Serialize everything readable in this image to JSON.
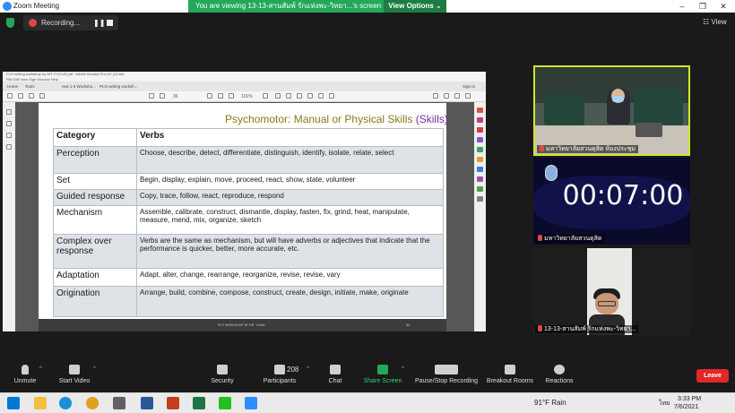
{
  "window": {
    "title": "Zoom Meeting",
    "controls": [
      "–",
      "❐",
      "✕"
    ]
  },
  "share_banner": {
    "message": "You are viewing 13-13-สานสัมพ์ รักแห่งพะ-วิทยา...'s screen",
    "view_options": "View Options ⌄"
  },
  "recording": {
    "label": "Recording...",
    "pause": "❚❚"
  },
  "view_button": "☷ View",
  "acrobat": {
    "title": "PLO writing workshop by DR. FOCUS.pdf - Adobe Acrobat Pro DC (32-bit)",
    "menu": "File   Edit   View   Sign   Window   Help",
    "tabs": [
      "Home",
      "Tools",
      "nea 1-3 Worksho...",
      "PLO writing worksh..."
    ],
    "sign_in": "Sign In",
    "zoom": "101%",
    "page": "36"
  },
  "slide": {
    "title_main": "Psychomotor: Manual or Physical Skills",
    "title_accent": "(Skills)",
    "footer": "PLO WORKSHOP BY DR. YUMA",
    "page_number": "34",
    "table": {
      "headers": [
        "Category",
        "Verbs"
      ],
      "rows": [
        {
          "category": "Perception",
          "verbs": "Choose, describe, detect, differentiate, distinguish, identify, isolate, relate, select"
        },
        {
          "category": "Set",
          "verbs": "Begin, display, explain, move, proceed, react, show, state, volunteer"
        },
        {
          "category": "Guided response",
          "verbs": "Copy, trace, follow, react, reproduce, respond"
        },
        {
          "category": "Mechanism",
          "verbs": "Assemble, calibrate, construct, dismantle, display, fasten, fix, grind, heat, manipulate, measure, mend, mix, organize, sketch"
        },
        {
          "category": "Complex over response",
          "verbs": "Verbs are the same as mechanism, but will have adverbs or adjectives that indicate that the performance is quicker, better, more accurate, etc."
        },
        {
          "category": "Adaptation",
          "verbs": "Adapt, alter, change, rearrange, reorganize, revise, revise, vary"
        },
        {
          "category": "Origination",
          "verbs": "Arrange, build, combine, compose, construct, create, design, initiate, make, originate"
        }
      ]
    }
  },
  "participants_tiles": [
    {
      "name": "มหาวิทยาลัยสวนดุสิต ห้องประชุม"
    },
    {
      "name": "มหาวิทยาลัยสวนดุสิต",
      "timer": "00:07:00"
    },
    {
      "name": "13-13-สานสัมพ์ รักแห่งพะ-วิทยา..."
    }
  ],
  "toolbar": {
    "unmute": "Unmute",
    "start_video": "Start Video",
    "security": "Security",
    "participants": "Participants",
    "participants_count": "208",
    "chat": "Chat",
    "share_screen": "Share Screen",
    "pause_recording": "Pause/Stop Recording",
    "breakout": "Breakout Rooms",
    "reactions": "Reactions",
    "leave": "Leave"
  },
  "taskbar": {
    "weather": "91°F  Rain",
    "lang": "ไทย",
    "time": "3:33 PM",
    "date": "7/6/2021"
  },
  "colors": {
    "zoom_green": "#23a859",
    "leave_red": "#e02828",
    "active_speaker": "#d5e52a",
    "slide_title": "#8a7a1a",
    "slide_accent": "#7030a0"
  }
}
